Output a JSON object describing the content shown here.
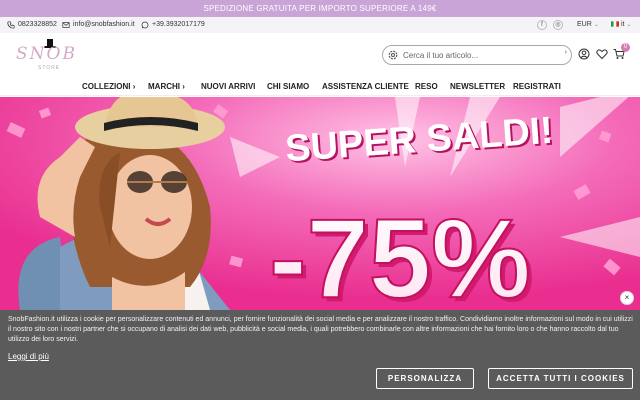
{
  "promo": {
    "text": "SPEDIZIONE GRATUITA PER IMPORTO SUPERIORE A 149€"
  },
  "contact": {
    "phone": "0823328852",
    "email": "info@snobfashion.it",
    "whatsapp": "+39.3932017179"
  },
  "topbar": {
    "social": [
      "f",
      "◎"
    ],
    "currency": "EUR",
    "language": "it"
  },
  "logo": {
    "text": "SNOB",
    "sub": "STORE"
  },
  "search": {
    "placeholder": "Cerca il tuo articolo..."
  },
  "cart": {
    "count": "0"
  },
  "nav": {
    "items": [
      {
        "label": "COLLEZIONI",
        "arrow": "›"
      },
      {
        "label": "MARCHI",
        "arrow": "›"
      },
      {
        "label": "NUOVI ARRIVI"
      },
      {
        "label": "CHI SIAMO"
      },
      {
        "label": "ASSISTENZA CLIENTE"
      },
      {
        "label": "RESO"
      },
      {
        "label": "NEWSLETTER"
      },
      {
        "label": "REGISTRATI"
      }
    ]
  },
  "hero": {
    "headline": "SUPER SALDI!",
    "discount": "-75%"
  },
  "cookie": {
    "text": "SnobFashion.it utilizza i cookie per personalizzare contenuti ed annunci, per fornire funzionalità dei social media e per analizzare il nostro traffico. Condividiamo inoltre informazioni sul modo in cui utilizzi il nostro sito con i nostri partner che si occupano di analisi dei dati web, pubblicità e social media, i quali potrebbero combinarle con altre informazioni che hai fornito loro o che hanno raccolto dal tuo utilizzo dei loro servizi.",
    "link": "Leggi di più",
    "customize": "PERSONALIZZA",
    "accept": "ACCETTA TUTTI I COOKIES",
    "close": "×"
  },
  "colors": {
    "brand": "#d3a9c8",
    "promo": "#c8a5d6",
    "hero": "#ec3f9b",
    "cookie_bg": "#5b5b5b"
  }
}
